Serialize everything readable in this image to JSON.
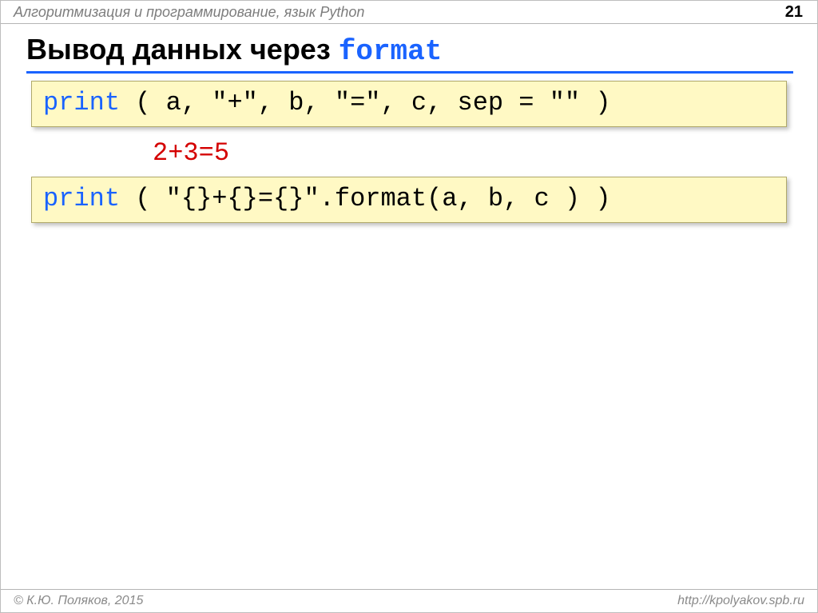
{
  "header": {
    "title": "Алгоритмизация и программирование, язык Python",
    "page": "21"
  },
  "title": {
    "text": "Вывод данных через ",
    "code": "format"
  },
  "code1": {
    "kw": "print",
    "rest": " ( a, \"+\", b, \"=\", c, sep = \"\" )"
  },
  "output1": "2+3=5",
  "code2": {
    "kw": "print",
    "rest": " ( \"{}+{}={}\".format(a, b, c ) )"
  },
  "footer": {
    "left": "© К.Ю. Поляков, 2015",
    "right": "http://kpolyakov.spb.ru"
  }
}
